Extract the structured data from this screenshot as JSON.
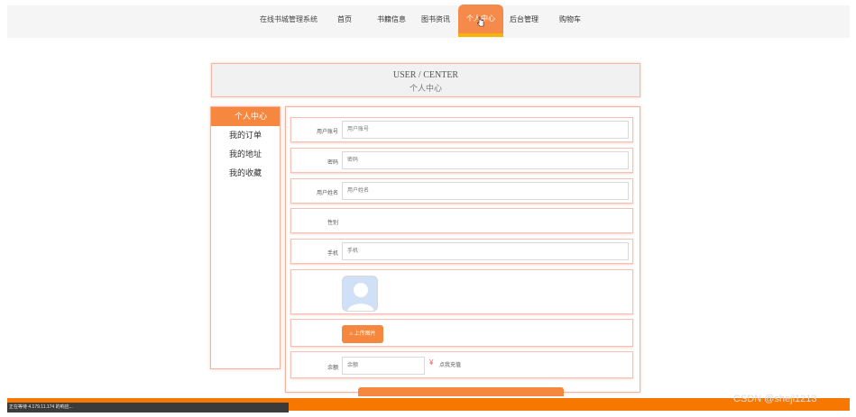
{
  "nav": {
    "site_title": "在线书城管理系统",
    "items": [
      {
        "label": "首页"
      },
      {
        "label": "书籍信息"
      },
      {
        "label": "图书资讯"
      },
      {
        "label": "个人中心"
      },
      {
        "label": "后台管理"
      },
      {
        "label": "购物车"
      }
    ],
    "active_index": 3
  },
  "header": {
    "title_en": "USER / CENTER",
    "title_zh": "个人中心"
  },
  "sidebar": {
    "items": [
      {
        "label": "个人中心"
      },
      {
        "label": "我的订单"
      },
      {
        "label": "我的地址"
      },
      {
        "label": "我的收藏"
      }
    ]
  },
  "form": {
    "account": {
      "label": "用户账号",
      "placeholder": "用户账号"
    },
    "password": {
      "label": "密码",
      "placeholder": "密码"
    },
    "name": {
      "label": "用户姓名",
      "placeholder": "用户姓名"
    },
    "gender": {
      "label": "性别"
    },
    "phone": {
      "label": "手机",
      "placeholder": "手机"
    },
    "upload": {
      "label": "上传图片"
    },
    "balance": {
      "label": "余额",
      "placeholder": "余额",
      "recharge_label": "点我充值"
    }
  },
  "status_bar": {
    "text": "正在等待 4.179.11.174 的响应..."
  },
  "watermark": {
    "text": "CSDN @shejl1213"
  },
  "colors": {
    "accent": "#f5873f",
    "nav_active": "#f58a4b",
    "bottom_bar": "#f77800"
  }
}
